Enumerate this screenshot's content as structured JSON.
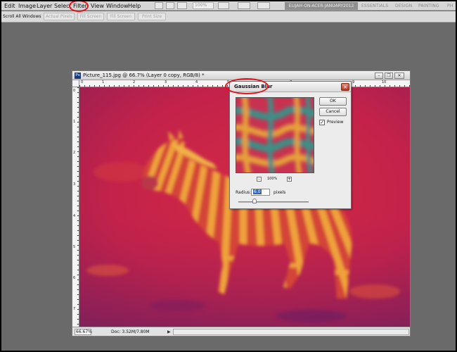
{
  "menubar": {
    "items": [
      "Edit",
      "Image",
      "Layer",
      "Select",
      "Filter",
      "View",
      "Window",
      "Help"
    ],
    "zoom": "100%",
    "workspace": "ELIJAH-ON-ACER-JANUARY2012",
    "workspaces": [
      "ESSENTIALS",
      "DESIGN",
      "PAINTING",
      "PH"
    ]
  },
  "options": {
    "scroll_all": "Scroll All Windows",
    "buttons": [
      "Actual Pixels",
      "Fill Screen",
      "Fill Screen",
      "Print Size"
    ]
  },
  "document": {
    "title": "Picture_115.jpg @ 66.7% (Layer 0 copy, RGB/8) *",
    "icon": "Ps",
    "ruler_top": [
      "0",
      "1",
      "2",
      "3",
      "4",
      "5",
      "6",
      "7",
      "8",
      "9",
      "10"
    ],
    "ruler_left": [
      "0",
      "1",
      "2",
      "3",
      "4",
      "5",
      "6",
      "7"
    ],
    "zoom": "66.67%",
    "doc_size": "Doc: 3.52M/7.80M",
    "status_arrow": "▶"
  },
  "dialog": {
    "title": "Gaussian Blur",
    "ok": "OK",
    "cancel": "Cancel",
    "preview_label": "Preview",
    "zoom": "100%",
    "radius_label": "Radius:",
    "radius_value": "6.0",
    "units": "pixels",
    "minus": "-",
    "plus": "+",
    "close": "×"
  },
  "colors": {
    "annotation": "#e3121b",
    "canvas_red": "#c0254a",
    "stripe_orange": "#e7a13a",
    "preview_teal": "#3d8f86"
  },
  "icons": {
    "close": "close-icon",
    "checkbox": "checkbox-icon"
  }
}
